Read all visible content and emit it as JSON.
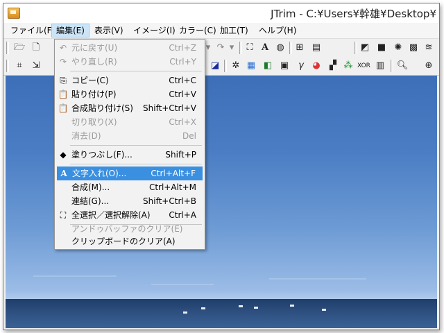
{
  "window": {
    "title": "JTrim - C:¥Users¥幹雄¥Desktop¥"
  },
  "menubar": [
    {
      "label": "ファイル(F)"
    },
    {
      "label": "編集(E)"
    },
    {
      "label": "表示(V)"
    },
    {
      "label": "イメージ(I)"
    },
    {
      "label": "カラー(C)"
    },
    {
      "label": "加工(T)"
    },
    {
      "label": "ヘルプ(H)"
    }
  ],
  "edit_menu": [
    {
      "label": "元に戻す(U)",
      "shortcut": "Ctrl+Z",
      "icon": "undo-icon",
      "glyph": "↶",
      "disabled": true
    },
    {
      "label": "やり直し(R)",
      "shortcut": "Ctrl+Y",
      "icon": "redo-icon",
      "glyph": "↷",
      "disabled": true
    },
    {
      "label": "コピー(C)",
      "shortcut": "Ctrl+C",
      "icon": "copy-icon",
      "glyph": "⎘",
      "disabled": false
    },
    {
      "label": "貼り付け(P)",
      "shortcut": "Ctrl+V",
      "icon": "paste-icon",
      "glyph": "📋",
      "disabled": false
    },
    {
      "label": "合成貼り付け(S)",
      "shortcut": "Shift+Ctrl+V",
      "icon": "composite-paste-icon",
      "glyph": "📋",
      "disabled": false
    },
    {
      "label": "切り取り(X)",
      "shortcut": "Ctrl+X",
      "icon": "",
      "glyph": "",
      "disabled": true
    },
    {
      "label": "消去(D)",
      "shortcut": "Del",
      "icon": "",
      "glyph": "",
      "disabled": true
    },
    {
      "label": "塗りつぶし(F)...",
      "shortcut": "Shift+P",
      "icon": "fill-bucket-icon",
      "glyph": "◆",
      "disabled": false
    },
    {
      "label": "文字入れ(O)...",
      "shortcut": "Ctrl+Alt+F",
      "icon": "text-insert-icon",
      "glyph": "A",
      "disabled": false,
      "highlight": true
    },
    {
      "label": "合成(M)...",
      "shortcut": "Ctrl+Alt+M",
      "icon": "",
      "glyph": "",
      "disabled": false
    },
    {
      "label": "連結(G)...",
      "shortcut": "Shift+Ctrl+B",
      "icon": "",
      "glyph": "",
      "disabled": false
    },
    {
      "label": "全選択／選択解除(A)",
      "shortcut": "Ctrl+A",
      "icon": "select-all-icon",
      "glyph": "⛶",
      "disabled": false
    },
    {
      "label": "アンドゥバッファのクリア(E)",
      "shortcut": "",
      "icon": "",
      "glyph": "",
      "disabled": true
    },
    {
      "label": "クリップボードのクリア(A)",
      "shortcut": "",
      "icon": "",
      "glyph": "",
      "disabled": false
    }
  ]
}
